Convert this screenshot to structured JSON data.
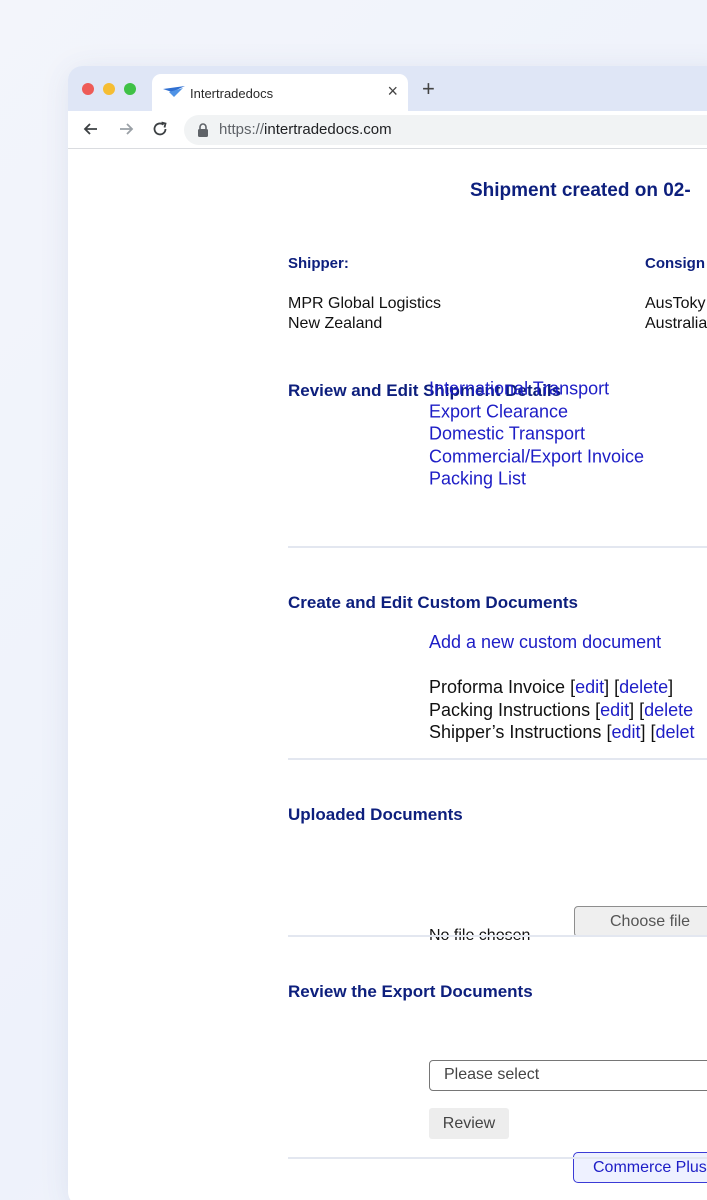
{
  "browser": {
    "tab_title": "Intertradedocs",
    "tab_close": "×",
    "new_tab": "+",
    "url_scheme": "https://",
    "url_host": "intertradedocs.com"
  },
  "page": {
    "title": "Shipment created on 02-",
    "shipper_label": "Shipper:",
    "shipper_name": "MPR Global Logistics",
    "shipper_country": "New Zealand",
    "consignee_label": "Consign",
    "consignee_name": "AusToky",
    "consignee_country": "Australia",
    "review_edit_heading": "Review and Edit Shipment Details",
    "detail_links": [
      "International Transport",
      "Export Clearance",
      "Domestic Transport",
      "Commercial/Export Invoice",
      "Packing List"
    ],
    "custom_heading": "Create and Edit Custom Documents",
    "add_custom_link": "Add a new custom document",
    "custom_docs": [
      {
        "name": "Proforma Invoice",
        "edit": "edit",
        "delete": "delete"
      },
      {
        "name": "Packing Instructions",
        "edit": "edit",
        "delete": "delete"
      },
      {
        "name": "Shipper’s Instructions",
        "edit": "edit",
        "delete": "delet"
      }
    ],
    "uploaded_heading": "Uploaded Documents",
    "no_file": "No file chosen",
    "choose_file": "Choose file",
    "export_heading": "Review the Export Documents",
    "select_placeholder": "Please select",
    "review_button": "Review",
    "commerce_button": "Commerce Plus"
  },
  "colors": {
    "heading": "#0d1f7d",
    "link": "#1d1dc6",
    "tabstrip": "#dfe6f6"
  }
}
